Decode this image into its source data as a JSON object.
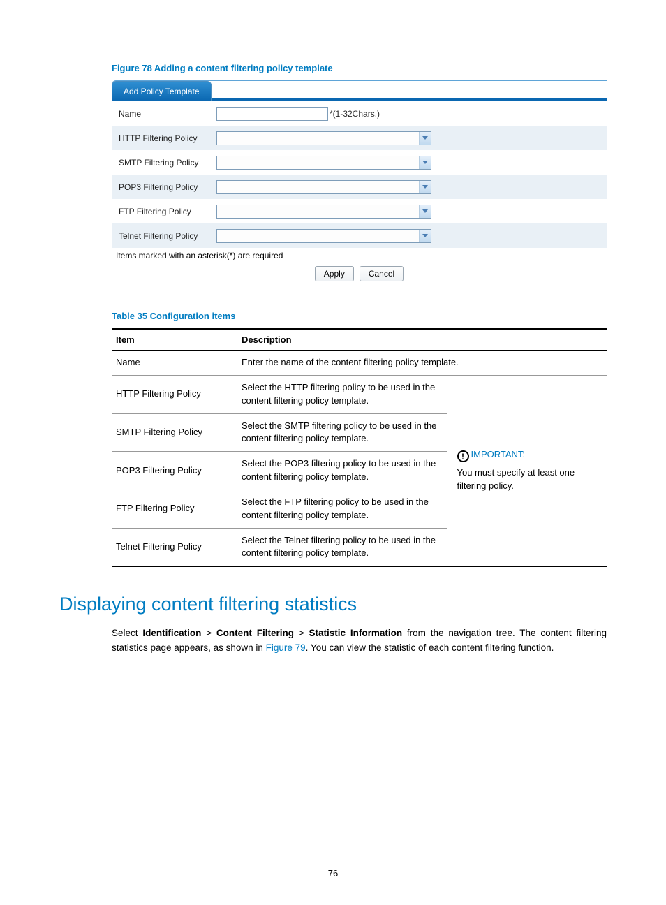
{
  "figureCaption": "Figure 78 Adding a content filtering policy template",
  "tab": "Add Policy Template",
  "formRows": [
    {
      "label": "Name",
      "type": "text",
      "hint": "*(1-32Chars.)"
    },
    {
      "label": "HTTP Filtering Policy",
      "type": "select"
    },
    {
      "label": "SMTP Filtering Policy",
      "type": "select"
    },
    {
      "label": "POP3 Filtering Policy",
      "type": "select"
    },
    {
      "label": "FTP Filtering Policy",
      "type": "select"
    },
    {
      "label": "Telnet Filtering Policy",
      "type": "select"
    }
  ],
  "requiredNote": "Items marked with an asterisk(*) are required",
  "applyLabel": "Apply",
  "cancelLabel": "Cancel",
  "tableCaption": "Table 35 Configuration items",
  "th1": "Item",
  "th2": "Description",
  "tableRows": [
    {
      "item": "Name",
      "desc": "Enter the name of the content filtering policy template."
    },
    {
      "item": "HTTP Filtering Policy",
      "desc": "Select the HTTP filtering policy to be used in the content filtering policy template."
    },
    {
      "item": "SMTP Filtering Policy",
      "desc": "Select the SMTP filtering policy to be used in the content filtering policy template."
    },
    {
      "item": "POP3 Filtering Policy",
      "desc": "Select the POP3 filtering policy to be used in the content filtering policy template."
    },
    {
      "item": "FTP Filtering Policy",
      "desc": "Select the FTP filtering policy to be used in the content filtering policy template."
    },
    {
      "item": "Telnet Filtering Policy",
      "desc": "Select the Telnet filtering policy to be used in the content filtering policy template."
    }
  ],
  "important": {
    "label": "IMPORTANT:",
    "text": "You must specify at least one filtering policy."
  },
  "sectionHeading": "Displaying content filtering statistics",
  "para": {
    "pre": "Select ",
    "b1": "Identification",
    "sep": " > ",
    "b2": "Content Filtering",
    "b3": "Statistic Information",
    "mid": " from the navigation tree. The content filtering statistics page appears, as shown in ",
    "link": "Figure 79",
    "post": ". You can view the statistic of each content filtering function."
  },
  "pageNumber": "76"
}
